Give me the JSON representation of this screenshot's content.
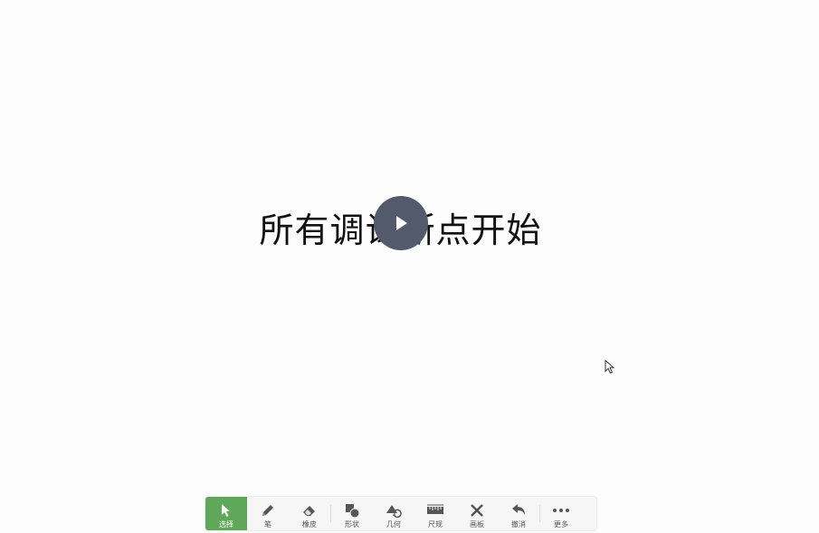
{
  "headline": {
    "text": "所有调试断点开始"
  },
  "play_button": {
    "icon": "play-icon"
  },
  "toolbar": {
    "active_color": "#5fa85a",
    "tools": [
      {
        "id": "select",
        "label": "选择",
        "icon": "pointer-icon",
        "active": true
      },
      {
        "id": "pen",
        "label": "笔",
        "icon": "pen-icon",
        "active": false
      },
      {
        "id": "eraser",
        "label": "橡皮",
        "icon": "eraser-icon",
        "active": false
      },
      {
        "id": "shape",
        "label": "形状",
        "icon": "shape-icon",
        "active": false
      },
      {
        "id": "geometry",
        "label": "几何",
        "icon": "geometry-icon",
        "active": false
      },
      {
        "id": "ruler",
        "label": "尺规",
        "icon": "ruler-icon",
        "active": false
      },
      {
        "id": "board",
        "label": "画板",
        "icon": "compass-icon",
        "active": false
      },
      {
        "id": "undo",
        "label": "撤消",
        "icon": "undo-icon",
        "active": false
      },
      {
        "id": "more",
        "label": "更多",
        "icon": "more-icon",
        "active": false
      }
    ]
  }
}
